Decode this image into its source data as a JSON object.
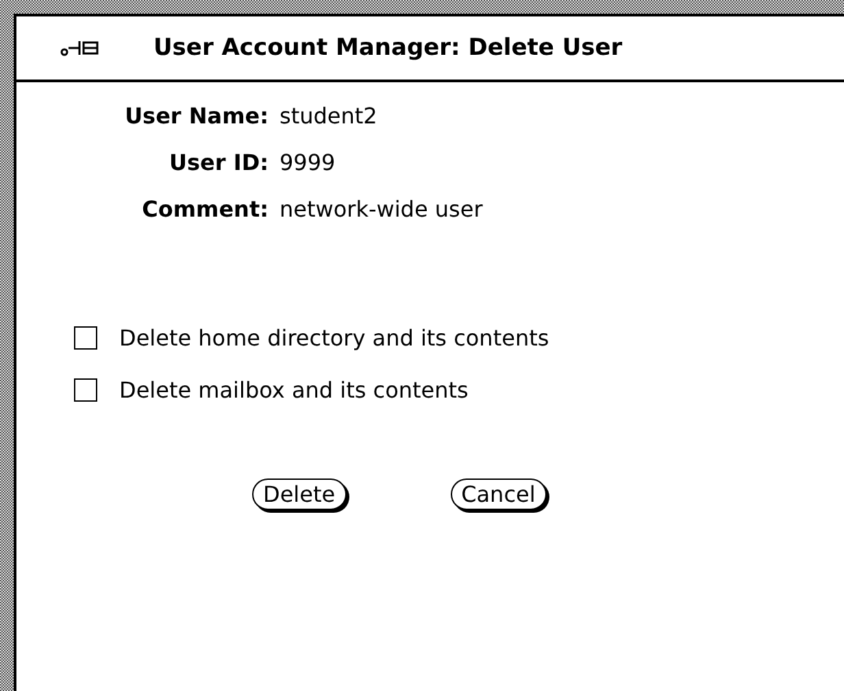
{
  "window": {
    "title": "User Account Manager: Delete User"
  },
  "fields": [
    {
      "label": "User Name:",
      "value": "student2"
    },
    {
      "label": "User ID:",
      "value": "9999"
    },
    {
      "label": "Comment:",
      "value": "network-wide user"
    }
  ],
  "options": [
    {
      "label": "Delete home directory and its contents",
      "checked": false
    },
    {
      "label": "Delete mailbox and its contents",
      "checked": false
    }
  ],
  "buttons": [
    {
      "label": "Delete"
    },
    {
      "label": "Cancel"
    }
  ]
}
